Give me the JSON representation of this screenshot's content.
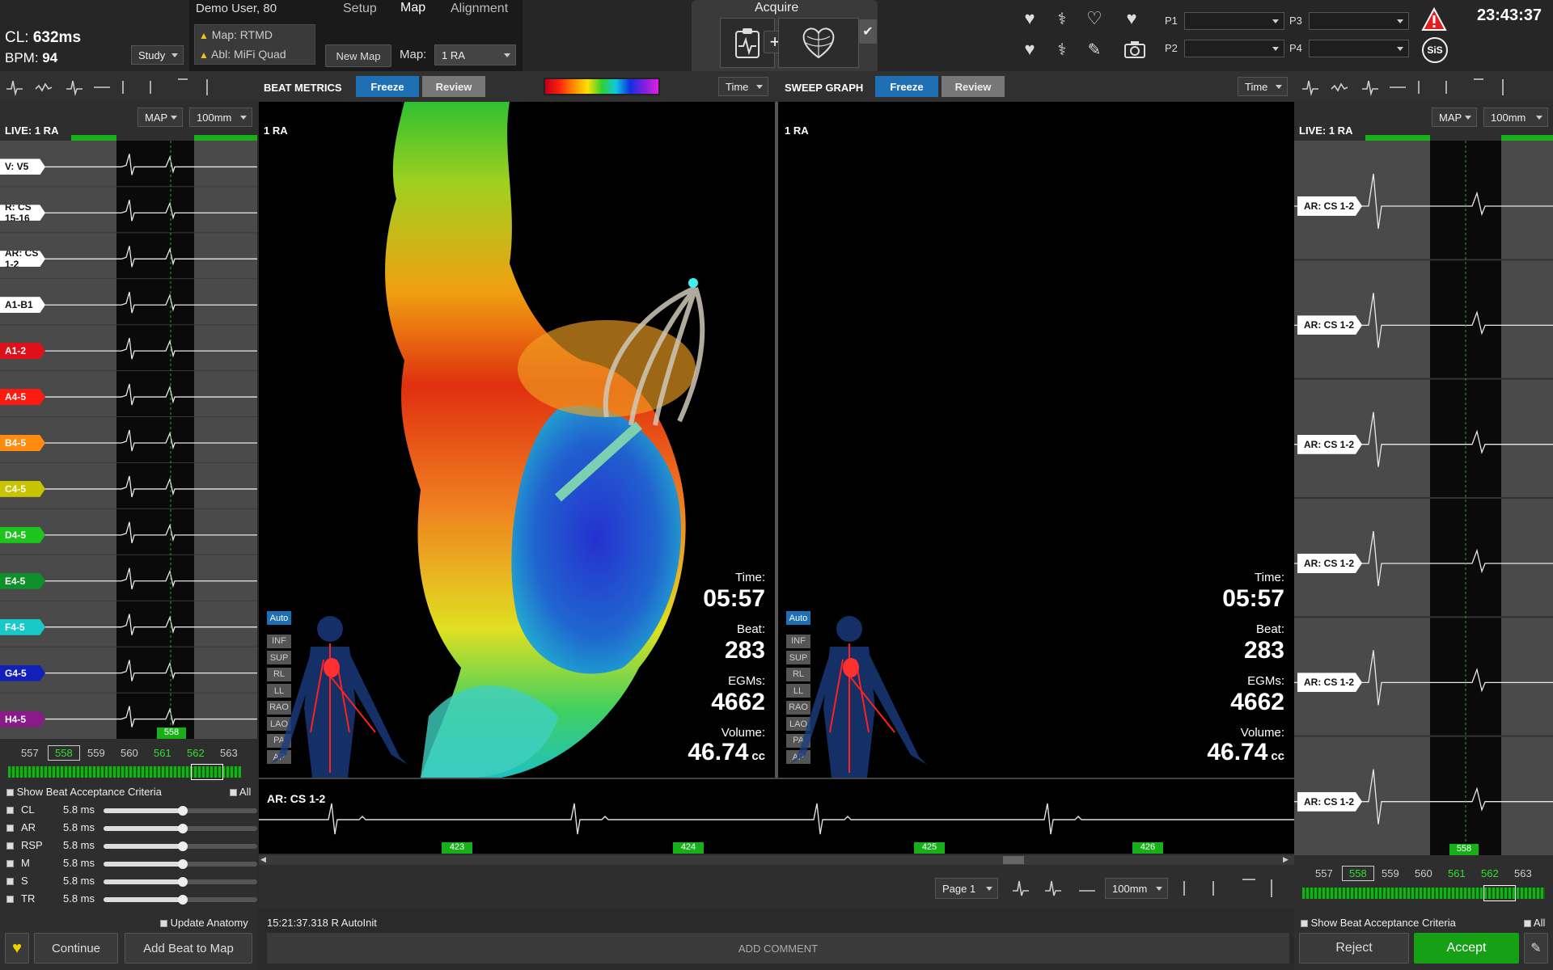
{
  "header": {
    "cl_label": "CL:",
    "cl_value": "632ms",
    "bpm_label": "BPM:",
    "bpm_value": "94",
    "study_label": "Study",
    "user": "Demo User, 80",
    "tabs": [
      "Setup",
      "Map",
      "Alignment"
    ],
    "map_status": "Map: RTMD",
    "abl_status": "Abl: MiFi Quad",
    "new_map": "New Map",
    "map_label": "Map:",
    "map_value": "1 RA",
    "acquire": "Acquire",
    "p_labels": [
      "P1",
      "P2",
      "P3",
      "P4"
    ],
    "clock": "23:43:37",
    "sis": "SiS"
  },
  "toolbar": {
    "beat_metrics": "BEAT METRICS",
    "freeze": "Freeze",
    "review": "Review",
    "time": "Time",
    "sweep_graph": "SWEEP GRAPH"
  },
  "left_panel": {
    "live": "LIVE: 1 RA",
    "map_dd": "MAP",
    "speed_dd": "100mm",
    "channels": [
      {
        "label": "V: V5",
        "color": "#ffffff",
        "text": "#111111"
      },
      {
        "label": "R: CS 15-16",
        "color": "#ffffff",
        "text": "#111111"
      },
      {
        "label": "AR: CS 1-2",
        "color": "#ffffff",
        "text": "#111111"
      },
      {
        "label": "A1-B1",
        "color": "#ffffff",
        "text": "#111111"
      },
      {
        "label": "A1-2",
        "color": "#e0101b",
        "text": "#ffffff"
      },
      {
        "label": "A4-5",
        "color": "#ff1a10",
        "text": "#ffffff"
      },
      {
        "label": "B4-5",
        "color": "#ff8a10",
        "text": "#ffffff"
      },
      {
        "label": "C4-5",
        "color": "#c9c400",
        "text": "#ffffff"
      },
      {
        "label": "D4-5",
        "color": "#1cc41c",
        "text": "#ffffff"
      },
      {
        "label": "E4-5",
        "color": "#0d8f2a",
        "text": "#ffffff"
      },
      {
        "label": "F4-5",
        "color": "#19c9c9",
        "text": "#ffffff"
      },
      {
        "label": "G4-5",
        "color": "#1020b8",
        "text": "#ffffff"
      },
      {
        "label": "H4-5",
        "color": "#8a1a8a",
        "text": "#ffffff"
      }
    ],
    "marker": "558",
    "beats": [
      "557",
      "558",
      "559",
      "560",
      "561",
      "562",
      "563"
    ],
    "show_criteria": "Show Beat Acceptance Criteria",
    "all": "All",
    "criteria": [
      {
        "name": "CL",
        "value": "5.8 ms"
      },
      {
        "name": "AR",
        "value": "5.8 ms"
      },
      {
        "name": "RSP",
        "value": "5.8 ms"
      },
      {
        "name": "M",
        "value": "5.8 ms"
      },
      {
        "name": "S",
        "value": "5.8 ms"
      },
      {
        "name": "TR",
        "value": "5.8 ms"
      }
    ],
    "update_anatomy": "Update Anatomy",
    "continue": "Continue",
    "add_beat": "Add Beat to Map"
  },
  "map_panel": {
    "title": "1 RA",
    "time_label": "Time:",
    "time_value": "05:57",
    "beat_label": "Beat:",
    "beat_value": "283",
    "egms_label": "EGMs:",
    "egms_value": "4662",
    "volume_label": "Volume:",
    "volume_value": "46.74",
    "volume_unit": "cc",
    "views": [
      "Auto",
      "INF",
      "SUP",
      "RL",
      "LL",
      "RAO",
      "LAO",
      "PA",
      "AP"
    ]
  },
  "sweep_panel": {
    "title": "1 RA",
    "time_label": "Time:",
    "time_value": "05:57",
    "beat_label": "Beat:",
    "beat_value": "283",
    "egms_label": "EGMs:",
    "egms_value": "4662",
    "volume_label": "Volume:",
    "volume_value": "46.74",
    "volume_unit": "cc",
    "views": [
      "Auto",
      "INF",
      "SUP",
      "RL",
      "LL",
      "RAO",
      "LAO",
      "PA",
      "AP"
    ]
  },
  "strip": {
    "label": "AR: CS 1-2",
    "markers": [
      "423",
      "424",
      "425",
      "426"
    ],
    "page": "Page 1",
    "speed": "100mm"
  },
  "log": {
    "entry": "15:21:37.318 R AutoInit",
    "add_comment": "ADD COMMENT"
  },
  "right_panel": {
    "live": "LIVE: 1 RA",
    "map_dd": "MAP",
    "speed_dd": "100mm",
    "channels": [
      "AR: CS 1-2",
      "AR: CS 1-2",
      "AR: CS 1-2",
      "AR: CS 1-2",
      "AR: CS 1-2",
      "AR: CS 1-2"
    ],
    "marker": "558",
    "beats": [
      "557",
      "558",
      "559",
      "560",
      "561",
      "562",
      "563"
    ],
    "show_criteria": "Show Beat Acceptance Criteria",
    "all": "All",
    "reject": "Reject",
    "accept": "Accept"
  },
  "colors": {
    "accent_blue": "#1f6fb5",
    "green": "#18b018",
    "accept_green": "#15a015"
  }
}
